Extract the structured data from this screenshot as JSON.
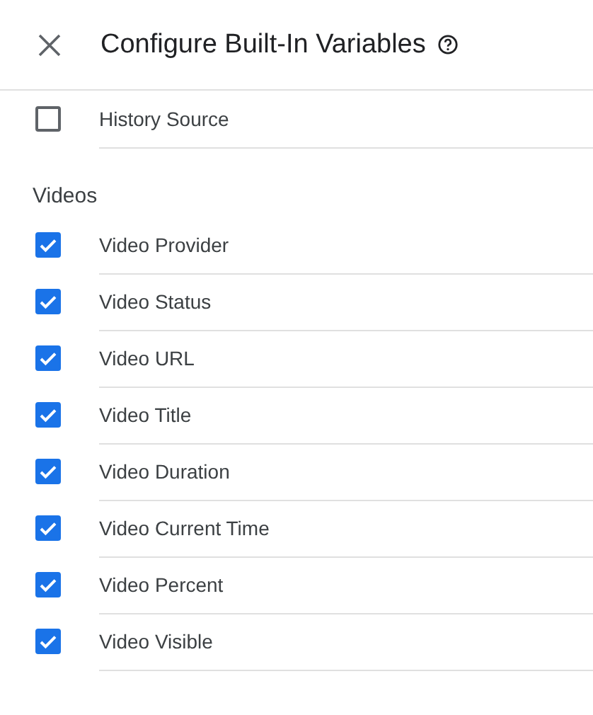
{
  "header": {
    "title": "Configure Built-In Variables"
  },
  "top_items": [
    {
      "label": "History Source",
      "checked": false
    }
  ],
  "sections": [
    {
      "title": "Videos",
      "items": [
        {
          "label": "Video Provider",
          "checked": true
        },
        {
          "label": "Video Status",
          "checked": true
        },
        {
          "label": "Video URL",
          "checked": true
        },
        {
          "label": "Video Title",
          "checked": true
        },
        {
          "label": "Video Duration",
          "checked": true
        },
        {
          "label": "Video Current Time",
          "checked": true
        },
        {
          "label": "Video Percent",
          "checked": true
        },
        {
          "label": "Video Visible",
          "checked": true
        }
      ]
    }
  ]
}
